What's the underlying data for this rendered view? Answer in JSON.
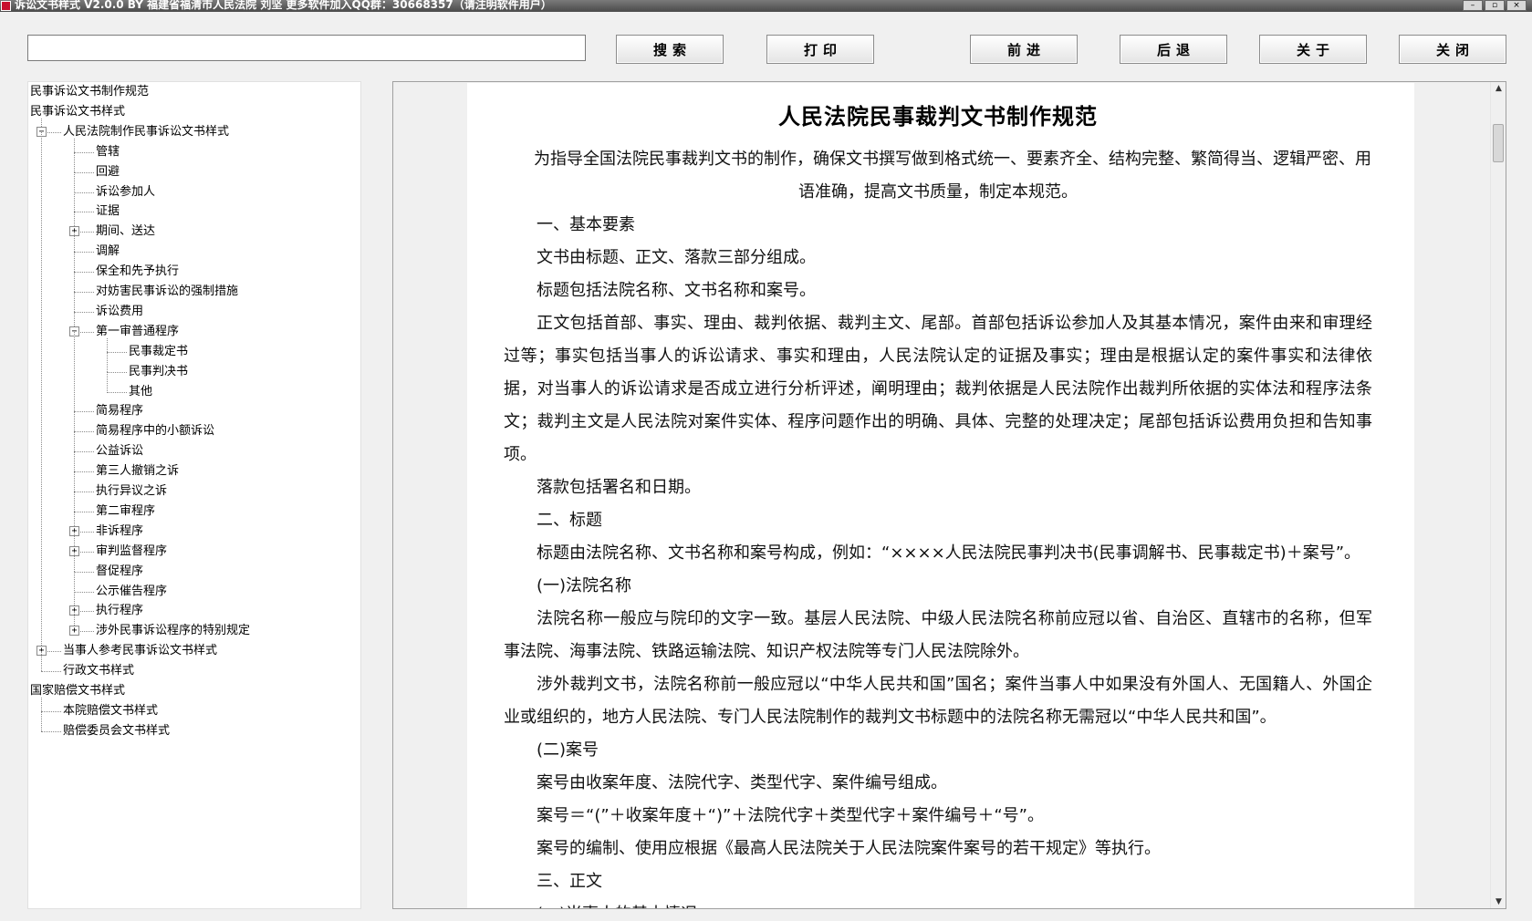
{
  "window": {
    "title": "诉讼文书样式 V2.0.0  BY 福建省福清市人民法院 刘坚  更多软件加入QQ群：30668357（请注明软件用户）",
    "controls": [
      "–",
      "▫",
      "×"
    ]
  },
  "toolbar": {
    "search_value": "",
    "buttons": {
      "search": "搜索",
      "print": "打印",
      "forward": "前进",
      "back": "后退",
      "about": "关于",
      "close": "关闭"
    }
  },
  "tree": {
    "nodes": [
      {
        "label": "民事诉讼文书制作规范",
        "level": 0,
        "toggle": null
      },
      {
        "label": "民事诉讼文书样式",
        "level": 0,
        "toggle": null
      },
      {
        "label": "人民法院制作民事诉讼文书样式",
        "level": 1,
        "toggle": "−"
      },
      {
        "label": "管辖",
        "level": 2,
        "toggle": null
      },
      {
        "label": "回避",
        "level": 2,
        "toggle": null
      },
      {
        "label": "诉讼参加人",
        "level": 2,
        "toggle": null
      },
      {
        "label": "证据",
        "level": 2,
        "toggle": null
      },
      {
        "label": "期间、送达",
        "level": 2,
        "toggle": "+"
      },
      {
        "label": "调解",
        "level": 2,
        "toggle": null
      },
      {
        "label": "保全和先予执行",
        "level": 2,
        "toggle": null
      },
      {
        "label": "对妨害民事诉讼的强制措施",
        "level": 2,
        "toggle": null
      },
      {
        "label": "诉讼费用",
        "level": 2,
        "toggle": null
      },
      {
        "label": "第一审普通程序",
        "level": 2,
        "toggle": "−"
      },
      {
        "label": "民事裁定书",
        "level": 3,
        "toggle": null
      },
      {
        "label": "民事判决书",
        "level": 3,
        "toggle": null
      },
      {
        "label": "其他",
        "level": 3,
        "toggle": null
      },
      {
        "label": "简易程序",
        "level": 2,
        "toggle": null
      },
      {
        "label": "简易程序中的小额诉讼",
        "level": 2,
        "toggle": null
      },
      {
        "label": "公益诉讼",
        "level": 2,
        "toggle": null
      },
      {
        "label": "第三人撤销之诉",
        "level": 2,
        "toggle": null
      },
      {
        "label": "执行异议之诉",
        "level": 2,
        "toggle": null
      },
      {
        "label": "第二审程序",
        "level": 2,
        "toggle": null
      },
      {
        "label": "非诉程序",
        "level": 2,
        "toggle": "+"
      },
      {
        "label": "审判监督程序",
        "level": 2,
        "toggle": "+"
      },
      {
        "label": "督促程序",
        "level": 2,
        "toggle": null
      },
      {
        "label": "公示催告程序",
        "level": 2,
        "toggle": null
      },
      {
        "label": "执行程序",
        "level": 2,
        "toggle": "+"
      },
      {
        "label": "涉外民事诉讼程序的特别规定",
        "level": 2,
        "toggle": "+"
      },
      {
        "label": "当事人参考民事诉讼文书样式",
        "level": 1,
        "toggle": "+"
      },
      {
        "label": "行政文书样式",
        "level": 1,
        "toggle": null
      },
      {
        "label": "国家赔偿文书样式",
        "level": 0,
        "toggle": null
      },
      {
        "label": "本院赔偿文书样式",
        "level": 1,
        "toggle": null
      },
      {
        "label": "赔偿委员会文书样式",
        "level": 1,
        "toggle": null
      }
    ]
  },
  "document": {
    "title": "人民法院民事裁判文书制作规范",
    "paragraphs": [
      "为指导全国法院民事裁判文书的制作，确保文书撰写做到格式统一、要素齐全、结构完整、繁简得当、逻辑严密、用语准确，提高文书质量，制定本规范。",
      "一、基本要素",
      "文书由标题、正文、落款三部分组成。",
      "标题包括法院名称、文书名称和案号。",
      "正文包括首部、事实、理由、裁判依据、裁判主文、尾部。首部包括诉讼参加人及其基本情况，案件由来和审理经过等；事实包括当事人的诉讼请求、事实和理由，人民法院认定的证据及事实；理由是根据认定的案件事实和法律依据，对当事人的诉讼请求是否成立进行分析评述，阐明理由；裁判依据是人民法院作出裁判所依据的实体法和程序法条文；裁判主文是人民法院对案件实体、程序问题作出的明确、具体、完整的处理决定；尾部包括诉讼费用负担和告知事项。",
      "落款包括署名和日期。",
      "二、标题",
      "标题由法院名称、文书名称和案号构成，例如：“××××人民法院民事判决书(民事调解书、民事裁定书)＋案号”。",
      "(一)法院名称",
      "法院名称一般应与院印的文字一致。基层人民法院、中级人民法院名称前应冠以省、自治区、直辖市的名称，但军事法院、海事法院、铁路运输法院、知识产权法院等专门人民法院除外。",
      "涉外裁判文书，法院名称前一般应冠以“中华人民共和国”国名；案件当事人中如果没有外国人、无国籍人、外国企业或组织的，地方人民法院、专门人民法院制作的裁判文书标题中的法院名称无需冠以“中华人民共和国”。",
      "(二)案号",
      "案号由收案年度、法院代字、类型代字、案件编号组成。",
      "案号＝“(”＋收案年度＋“)”＋法院代字＋类型代字＋案件编号＋“号”。",
      "案号的编制、使用应根据《最高人民法院关于人民法院案件案号的若干规定》等执行。",
      "三、正文",
      "(一)当事人的基本情况"
    ]
  },
  "scrollbar": {
    "up_arrow": "▲",
    "down_arrow": "▼"
  }
}
